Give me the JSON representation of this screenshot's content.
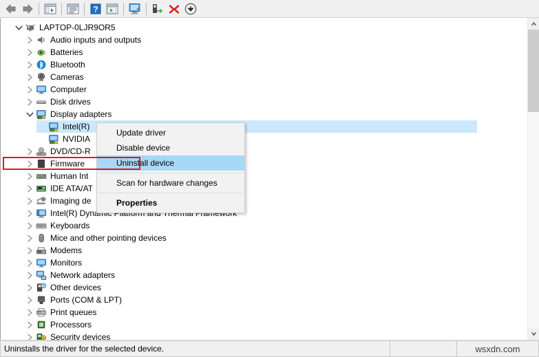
{
  "toolbar": {
    "buttons": [
      {
        "name": "back-arrow-icon",
        "label": "Back"
      },
      {
        "name": "forward-arrow-icon",
        "label": "Forward"
      },
      {
        "name": "show-hide-console-tree-icon",
        "label": "Show/Hide Console Tree"
      },
      {
        "name": "properties-icon",
        "label": "Properties"
      },
      {
        "name": "help-icon",
        "label": "Help"
      },
      {
        "name": "action-menu-icon",
        "label": "Action menu"
      },
      {
        "name": "scan-hardware-changes-icon",
        "label": "Scan for hardware changes"
      },
      {
        "name": "update-driver-icon",
        "label": "Update driver"
      },
      {
        "name": "uninstall-device-icon",
        "label": "Uninstall device"
      },
      {
        "name": "disable-device-icon",
        "label": "Disable device"
      }
    ]
  },
  "tree": {
    "root": {
      "label": "LAPTOP-0LJR9OR5",
      "icon": "computer-root-icon",
      "expanded": true
    },
    "items": [
      {
        "label": "Audio inputs and outputs",
        "icon": "speaker-icon",
        "level": 1,
        "expandable": true,
        "expanded": false
      },
      {
        "label": "Batteries",
        "icon": "battery-icon",
        "level": 1,
        "expandable": true,
        "expanded": false
      },
      {
        "label": "Bluetooth",
        "icon": "bluetooth-icon",
        "level": 1,
        "expandable": true,
        "expanded": false
      },
      {
        "label": "Cameras",
        "icon": "camera-icon",
        "level": 1,
        "expandable": true,
        "expanded": false
      },
      {
        "label": "Computer",
        "icon": "monitor-icon",
        "level": 1,
        "expandable": true,
        "expanded": false
      },
      {
        "label": "Disk drives",
        "icon": "disk-drive-icon",
        "level": 1,
        "expandable": true,
        "expanded": false
      },
      {
        "label": "Display adapters",
        "icon": "display-adapter-icon",
        "level": 1,
        "expandable": true,
        "expanded": true
      },
      {
        "label": "Intel(R)",
        "icon": "display-adapter-icon",
        "level": 2,
        "expandable": false,
        "selected": true
      },
      {
        "label": "NVIDIA",
        "icon": "display-adapter-icon",
        "level": 2,
        "expandable": false
      },
      {
        "label": "DVD/CD-R",
        "icon": "dvd-drive-icon",
        "level": 1,
        "expandable": true,
        "expanded": false
      },
      {
        "label": "Firmware",
        "icon": "firmware-icon",
        "level": 1,
        "expandable": true,
        "expanded": false
      },
      {
        "label": "Human Int",
        "icon": "keyboard-hid-icon",
        "level": 1,
        "expandable": true,
        "expanded": false
      },
      {
        "label": "IDE ATA/AT",
        "icon": "ide-controller-icon",
        "level": 1,
        "expandable": true,
        "expanded": false
      },
      {
        "label": "Imaging de",
        "icon": "imaging-device-icon",
        "level": 1,
        "expandable": true,
        "expanded": false
      },
      {
        "label": "Intel(R) Dynamic Platform and Thermal Framework",
        "icon": "system-device-icon",
        "level": 1,
        "expandable": true,
        "expanded": false
      },
      {
        "label": "Keyboards",
        "icon": "keyboard-icon",
        "level": 1,
        "expandable": true,
        "expanded": false
      },
      {
        "label": "Mice and other pointing devices",
        "icon": "mouse-icon",
        "level": 1,
        "expandable": true,
        "expanded": false
      },
      {
        "label": "Modems",
        "icon": "modem-icon",
        "level": 1,
        "expandable": true,
        "expanded": false
      },
      {
        "label": "Monitors",
        "icon": "monitor-icon",
        "level": 1,
        "expandable": true,
        "expanded": false
      },
      {
        "label": "Network adapters",
        "icon": "network-adapter-icon",
        "level": 1,
        "expandable": true,
        "expanded": false
      },
      {
        "label": "Other devices",
        "icon": "other-device-icon",
        "level": 1,
        "expandable": true,
        "expanded": false
      },
      {
        "label": "Ports (COM & LPT)",
        "icon": "port-icon",
        "level": 1,
        "expandable": true,
        "expanded": false
      },
      {
        "label": "Print queues",
        "icon": "printer-icon",
        "level": 1,
        "expandable": true,
        "expanded": false
      },
      {
        "label": "Processors",
        "icon": "processor-icon",
        "level": 1,
        "expandable": true,
        "expanded": false
      },
      {
        "label": "Security devices",
        "icon": "security-device-icon",
        "level": 1,
        "expandable": true,
        "expanded": false
      }
    ]
  },
  "context_menu": {
    "items": [
      {
        "label": "Update driver",
        "highlighted": false,
        "bold": false
      },
      {
        "label": "Disable device",
        "highlighted": false,
        "bold": false
      },
      {
        "label": "Uninstall device",
        "highlighted": true,
        "bold": false
      },
      {
        "separator": true
      },
      {
        "label": "Scan for hardware changes",
        "highlighted": false,
        "bold": false
      },
      {
        "separator": true
      },
      {
        "label": "Properties",
        "highlighted": false,
        "bold": true
      }
    ]
  },
  "status_bar": {
    "message": "Uninstalls the driver for the selected device.",
    "middle": "",
    "watermark": "wsxdn.com"
  },
  "colors": {
    "selection_fill": "#cce8ff",
    "menu_highlight": "#a8d8f8",
    "annotation_red": "#e01b1b",
    "toolbar_bg": "#f0f0f0",
    "menu_bg": "#f2f2f2"
  },
  "scrollbar": {
    "up_arrow": "scroll-up-arrow-icon",
    "down_arrow": "scroll-down-arrow-icon"
  }
}
